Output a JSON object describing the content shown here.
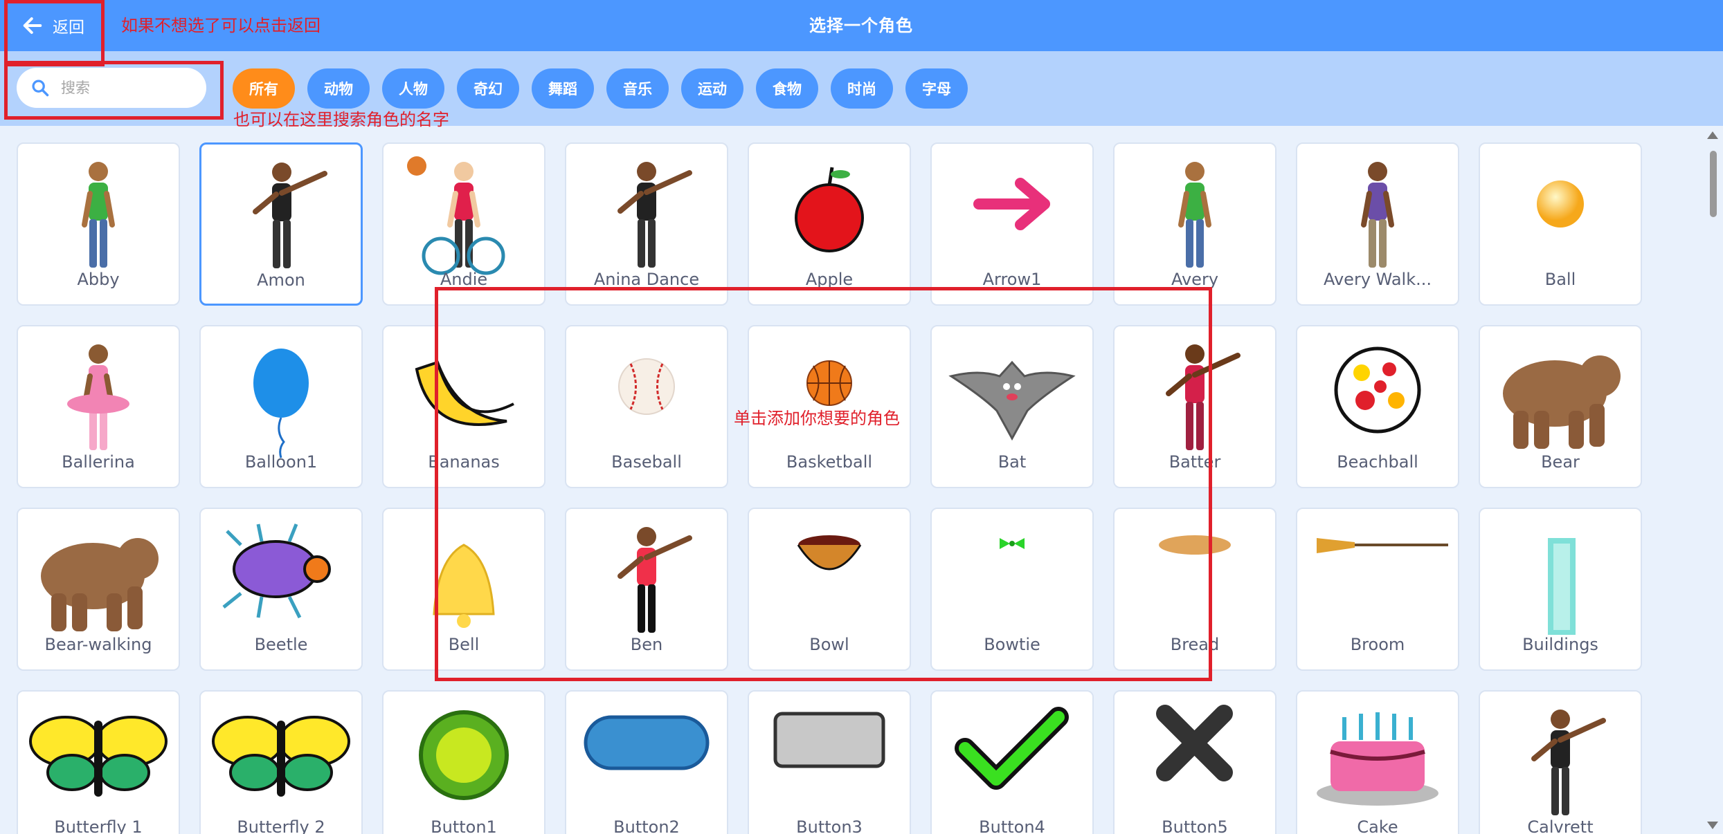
{
  "header": {
    "back_label": "返回",
    "title": "选择一个角色"
  },
  "search": {
    "placeholder": "搜索"
  },
  "categories": [
    "所有",
    "动物",
    "人物",
    "奇幻",
    "舞蹈",
    "音乐",
    "运动",
    "食物",
    "时尚",
    "字母"
  ],
  "annotations": {
    "back_hint": "如果不想选了可以点击返回",
    "search_hint": "也可以在这里搜索角色的名字",
    "grid_hint": "单击添加你想要的角色"
  },
  "sprites": [
    {
      "name": "Abby",
      "icon": "girl-icon"
    },
    {
      "name": "Amon",
      "icon": "dancer-icon"
    },
    {
      "name": "Andie",
      "icon": "wheelchair-basketball-icon"
    },
    {
      "name": "Anina Dance",
      "icon": "dancer-icon"
    },
    {
      "name": "Apple",
      "icon": "apple-icon"
    },
    {
      "name": "Arrow1",
      "icon": "arrow-icon"
    },
    {
      "name": "Avery",
      "icon": "girl-icon"
    },
    {
      "name": "Avery Walk...",
      "icon": "girl-walking-icon"
    },
    {
      "name": "Ball",
      "icon": "ball-icon"
    },
    {
      "name": "Ballerina",
      "icon": "ballerina-icon"
    },
    {
      "name": "Balloon1",
      "icon": "balloon-icon"
    },
    {
      "name": "Bananas",
      "icon": "bananas-icon"
    },
    {
      "name": "Baseball",
      "icon": "baseball-icon"
    },
    {
      "name": "Basketball",
      "icon": "basketball-icon"
    },
    {
      "name": "Bat",
      "icon": "bat-icon"
    },
    {
      "name": "Batter",
      "icon": "batter-icon"
    },
    {
      "name": "Beachball",
      "icon": "beachball-icon"
    },
    {
      "name": "Bear",
      "icon": "bear-icon"
    },
    {
      "name": "Bear-walking",
      "icon": "bear-icon"
    },
    {
      "name": "Beetle",
      "icon": "beetle-icon"
    },
    {
      "name": "Bell",
      "icon": "bell-icon"
    },
    {
      "name": "Ben",
      "icon": "runner-icon"
    },
    {
      "name": "Bowl",
      "icon": "bowl-icon"
    },
    {
      "name": "Bowtie",
      "icon": "bowtie-icon"
    },
    {
      "name": "Bread",
      "icon": "bread-icon"
    },
    {
      "name": "Broom",
      "icon": "broom-icon"
    },
    {
      "name": "Buildings",
      "icon": "building-icon"
    },
    {
      "name": "Butterfly 1",
      "icon": "butterfly-icon"
    },
    {
      "name": "Butterfly 2",
      "icon": "butterfly-icon"
    },
    {
      "name": "Button1",
      "icon": "round-button-icon"
    },
    {
      "name": "Button2",
      "icon": "pill-button-icon"
    },
    {
      "name": "Button3",
      "icon": "square-button-icon"
    },
    {
      "name": "Button4",
      "icon": "checkmark-icon"
    },
    {
      "name": "Button5",
      "icon": "x-mark-icon"
    },
    {
      "name": "Cake",
      "icon": "cake-icon"
    },
    {
      "name": "Calvrett",
      "icon": "dancer-icon"
    }
  ],
  "selected_sprite": "Amon",
  "colors": {
    "header": "#4c97ff",
    "filter_bar": "#b3d2fd",
    "active_tag": "#ff8c1a",
    "annotation": "#e0202b"
  }
}
